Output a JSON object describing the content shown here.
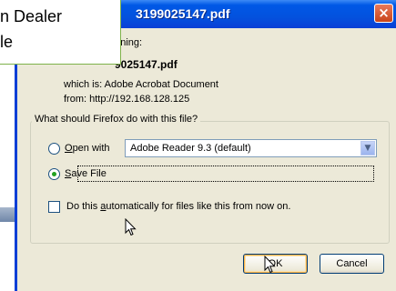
{
  "callout": {
    "line1": "n Dealer",
    "line2": "le"
  },
  "dialog": {
    "title": "3199025147.pdf",
    "close_icon": "×",
    "opening_label": "pening:",
    "filename": "9025147.pdf",
    "which_is": "which is:  Adobe Acrobat Document",
    "from": "from:  http://192.168.128.125",
    "question": "What should Firefox do with this file?",
    "open_with_prefix": "",
    "open_with_accel": "O",
    "open_with_rest": "pen with",
    "open_with_app": "Adobe Reader 9.3 (default)",
    "save_file_accel": "S",
    "save_file_rest": "ave File",
    "auto_prefix": "Do this ",
    "auto_accel": "a",
    "auto_rest": "utomatically for files like this from now on.",
    "ok_label": "OK",
    "cancel_label": "Cancel"
  },
  "state": {
    "selected_option": "save_file",
    "auto_checked": false
  },
  "colors": {
    "titlebar": "#0058e6",
    "close_button": "#c84419",
    "dialog_bg": "#ece9d8",
    "radio_dot": "#21a121"
  }
}
